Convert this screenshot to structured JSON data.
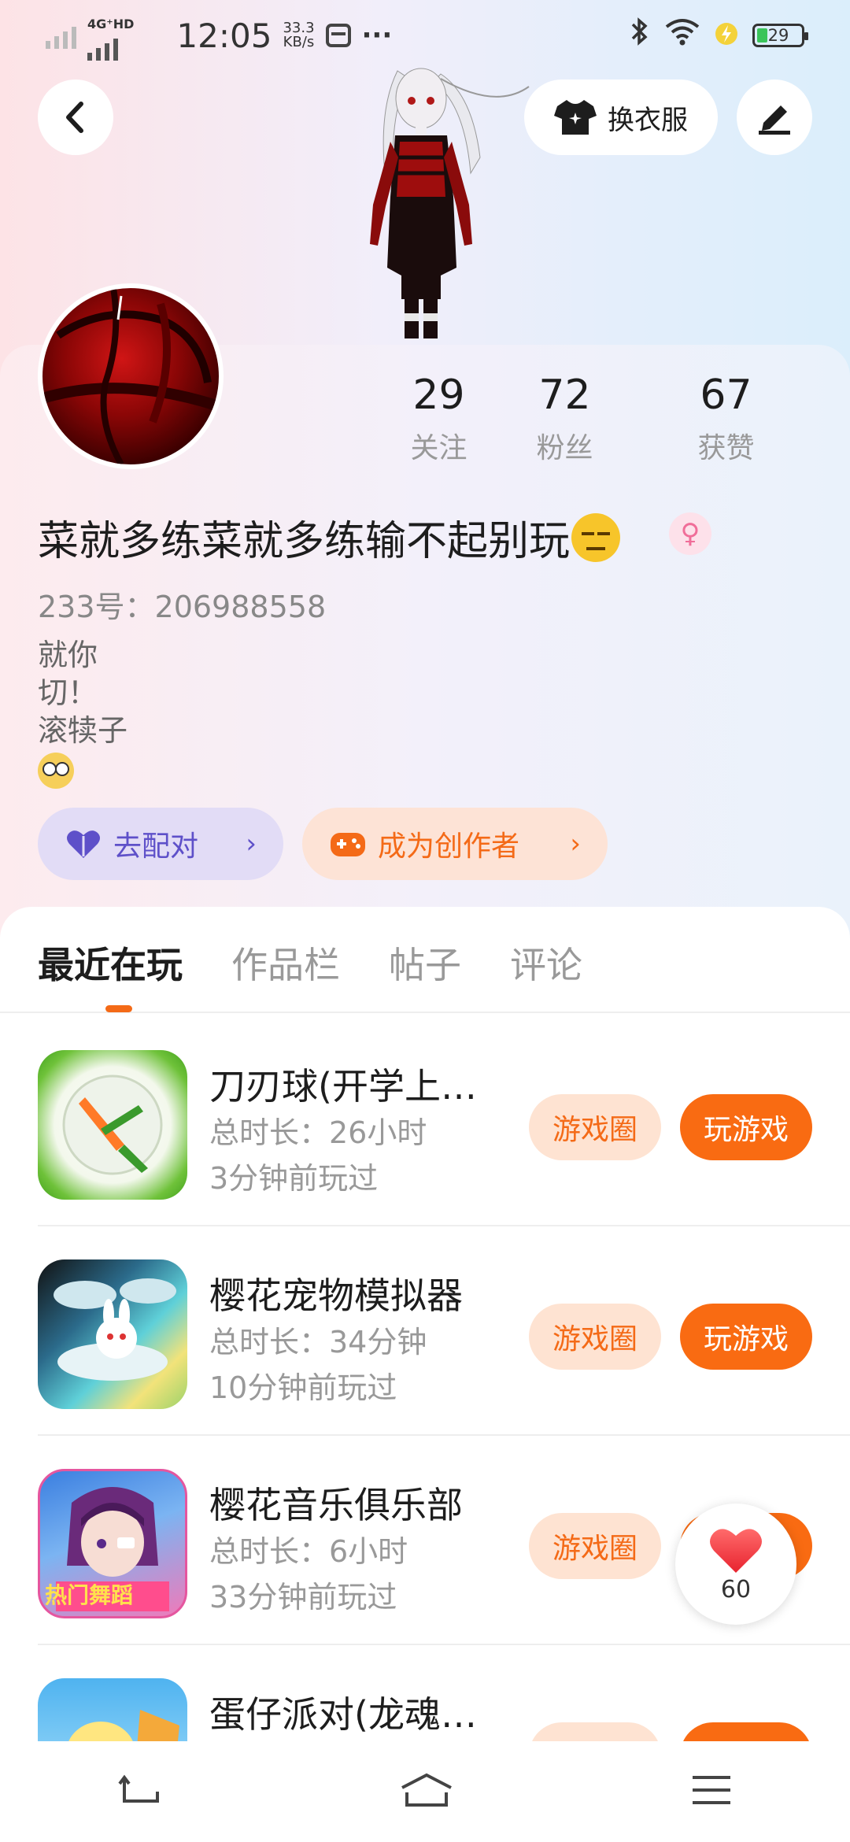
{
  "status_bar": {
    "network_label": "4G⁺HD",
    "time": "12:05",
    "speed_value": "33.3",
    "speed_unit": "KB/s",
    "more": "···",
    "battery": "29"
  },
  "header": {
    "outfit_label": "换衣服"
  },
  "profile": {
    "stats": [
      {
        "value": "29",
        "label": "关注"
      },
      {
        "value": "72",
        "label": "粉丝"
      },
      {
        "value": "67",
        "label": "获赞"
      }
    ],
    "username": "菜就多练菜就多练输不起别玩",
    "gender": "♀",
    "uid_label": "233号：",
    "uid": "206988558",
    "bio_lines": [
      "就你",
      "切！",
      "滚犊子"
    ],
    "actions": {
      "match_label": "去配对",
      "creator_label": "成为创作者"
    }
  },
  "tabs": [
    "最近在玩",
    "作品栏",
    "帖子",
    "评论"
  ],
  "games": [
    {
      "title": "刀刃球(开学上…",
      "duration": "总时长：26小时",
      "last_played": "3分钟前玩过"
    },
    {
      "title": "樱花宠物模拟器",
      "duration": "总时长：34分钟",
      "last_played": "10分钟前玩过"
    },
    {
      "title": "樱花音乐俱乐部",
      "duration": "总时长：6小时",
      "last_played": "33分钟前玩过",
      "icon_badge": "热门舞蹈"
    },
    {
      "title": "蛋仔派对(龙魂…",
      "duration": "",
      "last_played": ""
    }
  ],
  "game_buttons": {
    "circle": "游戏圈",
    "play": "玩游戏"
  },
  "like_fab": {
    "count": "60"
  },
  "colors": {
    "accent": "#f96b12",
    "match_purple": "#5e50c9",
    "pink": "#f06e99"
  }
}
